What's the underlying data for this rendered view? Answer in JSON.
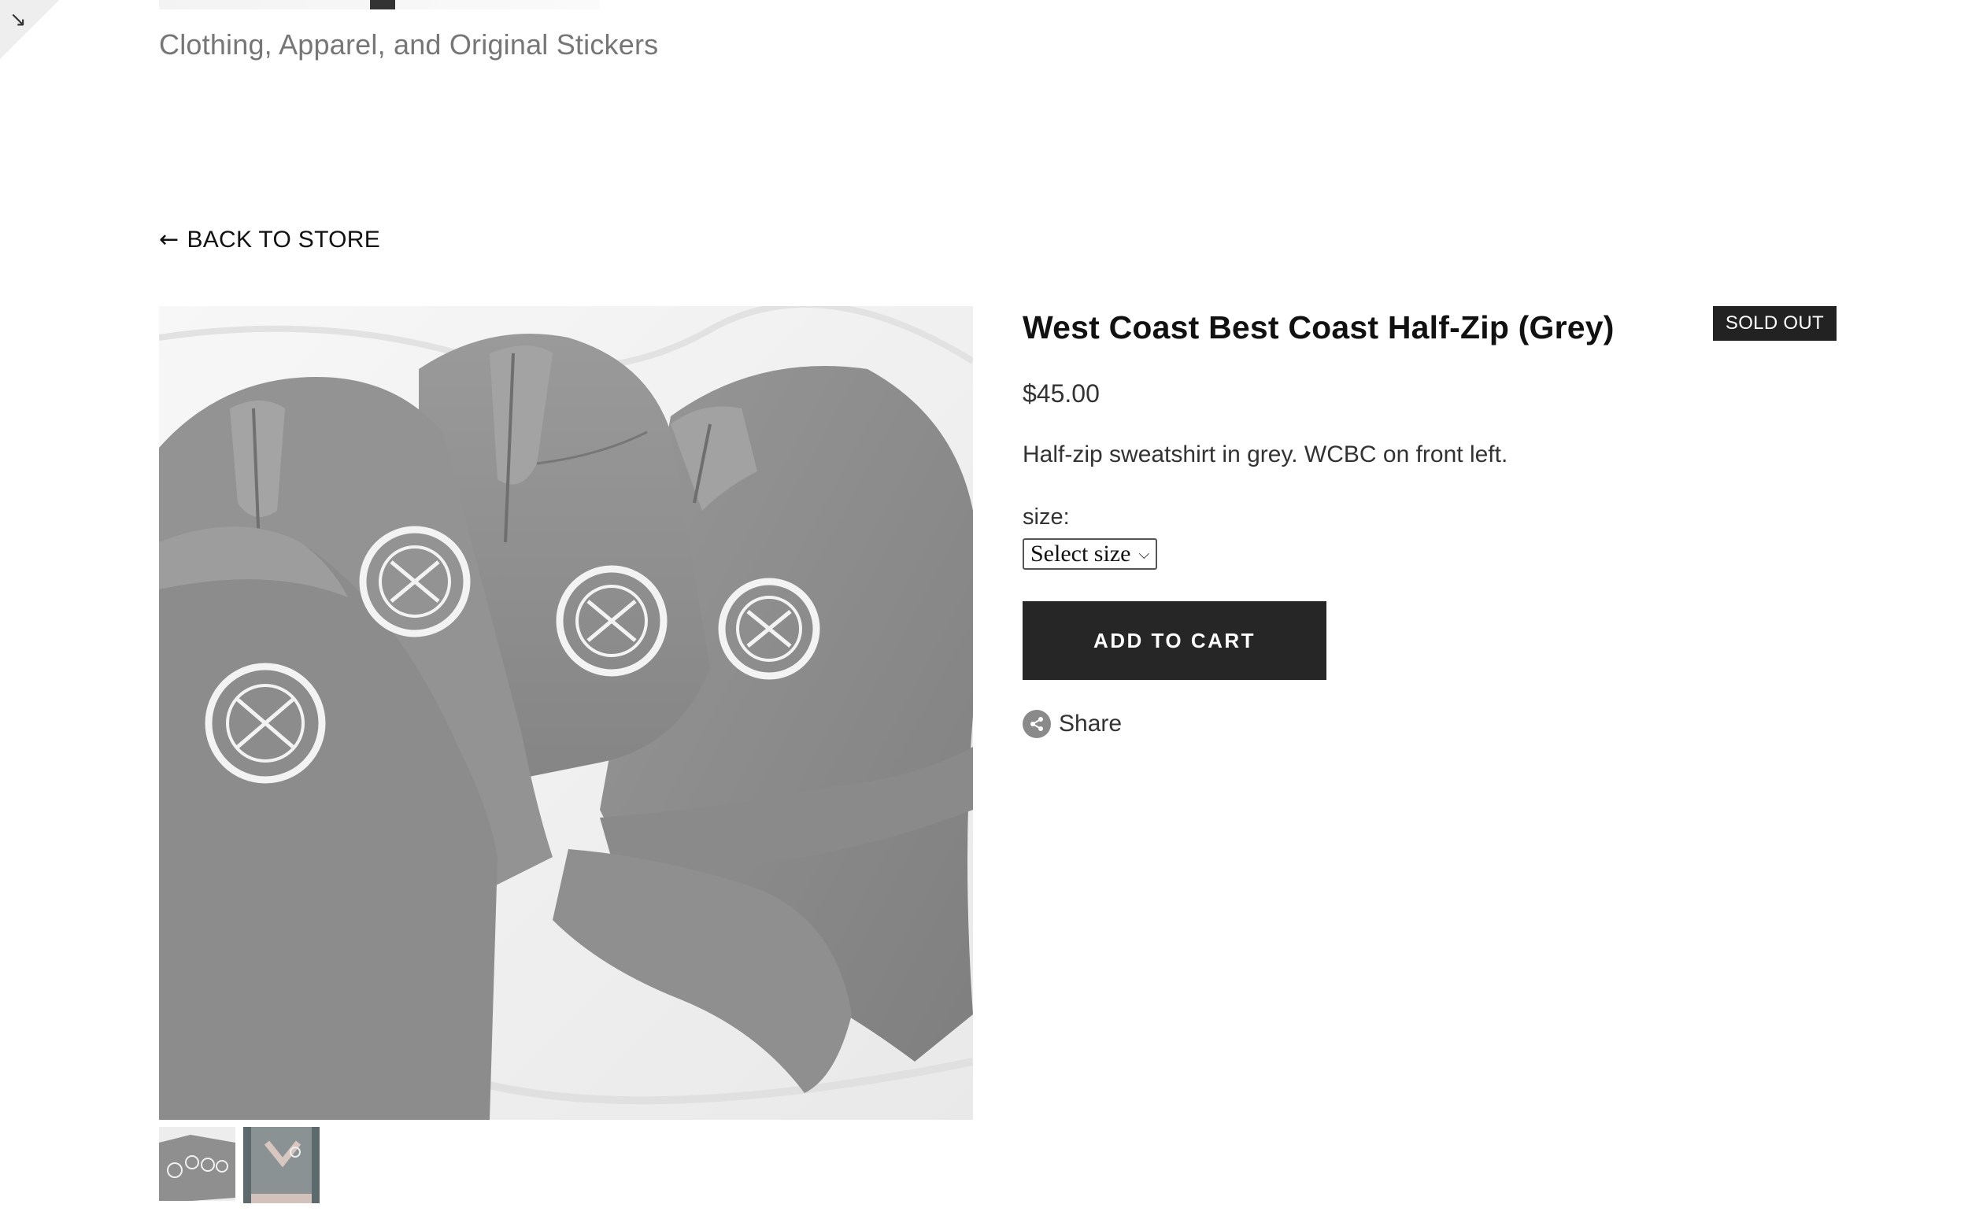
{
  "header": {
    "tagline": "Clothing, Apparel, and Original Stickers"
  },
  "nav": {
    "back_label": "BACK TO STORE"
  },
  "product": {
    "title": "West Coast Best Coast Half-Zip (Grey)",
    "badge": "SOLD OUT",
    "price": "$45.00",
    "description": "Half-zip sweatshirt in grey. WCBC on front left.",
    "size_label": "size:",
    "size_selected": "Select size",
    "add_to_cart": "ADD TO CART",
    "share_label": "Share",
    "main_image_alt": "Grey half-zip sweatshirts with West Coast Best Coast logo",
    "thumbnails": [
      {
        "alt": "Folded grey half-zips"
      },
      {
        "alt": "Grey half-zip worn"
      }
    ]
  },
  "colors": {
    "button_bg": "#262626",
    "badge_bg": "#222222",
    "sweatshirt_grey": "#8e8e8e"
  }
}
